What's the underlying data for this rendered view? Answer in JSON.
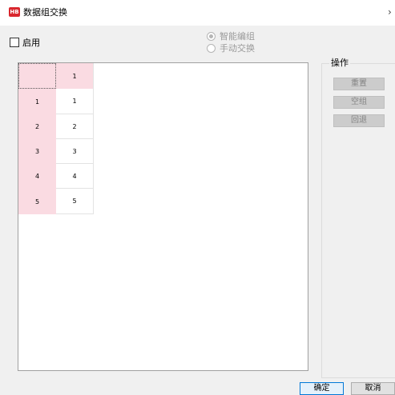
{
  "window": {
    "title": "数据组交换",
    "app_icon": "HB",
    "more": "›"
  },
  "enable": {
    "label": "启用",
    "checked": false
  },
  "mode": {
    "options": [
      {
        "label": "智能编组",
        "checked": true
      },
      {
        "label": "手动交换",
        "checked": false
      }
    ]
  },
  "grid": {
    "column_headers": [
      "1"
    ],
    "rows": [
      {
        "header": "1",
        "cells": [
          "1"
        ]
      },
      {
        "header": "2",
        "cells": [
          "2"
        ]
      },
      {
        "header": "3",
        "cells": [
          "3"
        ]
      },
      {
        "header": "4",
        "cells": [
          "4"
        ]
      },
      {
        "header": "5",
        "cells": [
          "5"
        ]
      }
    ]
  },
  "operations": {
    "legend": "操作",
    "reset_label": "重置",
    "clear_label": "空组",
    "undo_label": "回退"
  },
  "footer": {
    "ok_label": "确定",
    "cancel_label": "取消"
  },
  "colors": {
    "header_pink": "#fadbe2",
    "accent_blue": "#0078d7",
    "brand_red": "#d9272e"
  }
}
